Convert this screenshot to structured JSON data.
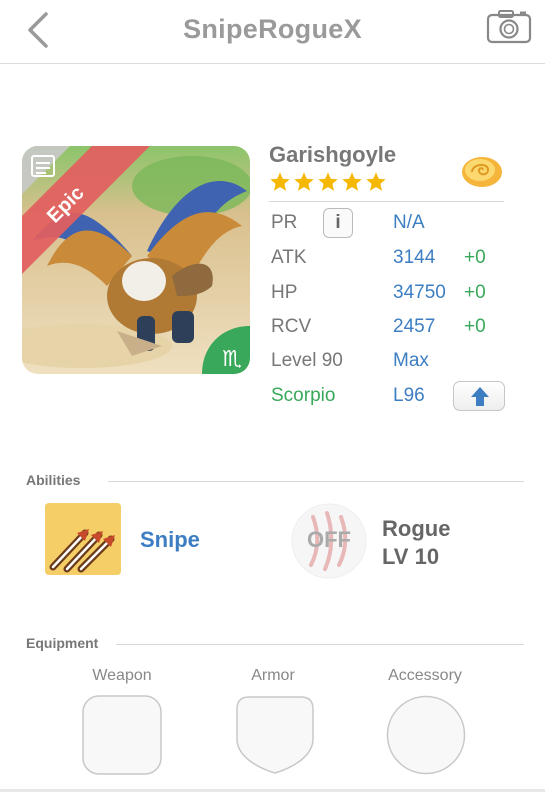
{
  "header": {
    "title": "SnipeRogueX"
  },
  "monster": {
    "name": "Garishgoyle",
    "rarity": "Epic",
    "stars": 5,
    "zodiac_symbol": "♏",
    "stats": {
      "pr": {
        "label": "PR",
        "value": "N/A"
      },
      "atk": {
        "label": "ATK",
        "value": "3144",
        "bonus": "+0"
      },
      "hp": {
        "label": "HP",
        "value": "34750",
        "bonus": "+0"
      },
      "rcv": {
        "label": "RCV",
        "value": "2457",
        "bonus": "+0"
      },
      "level": {
        "label": "Level 90",
        "value": "Max"
      },
      "zodiac": {
        "label": "Scorpio",
        "value": "L96"
      }
    }
  },
  "abilities": {
    "heading": "Abilities",
    "active": {
      "name": "Snipe"
    },
    "passive": {
      "status": "OFF",
      "name": "Rogue",
      "level": "LV 10"
    }
  },
  "equipment": {
    "heading": "Equipment",
    "slots": [
      "Weapon",
      "Armor",
      "Accessory"
    ]
  },
  "colors": {
    "accent_blue": "#3d7ec3",
    "bonus_green": "#3aa85b",
    "star_gold": "#f5b800",
    "epic_red": "#e25f5f"
  }
}
